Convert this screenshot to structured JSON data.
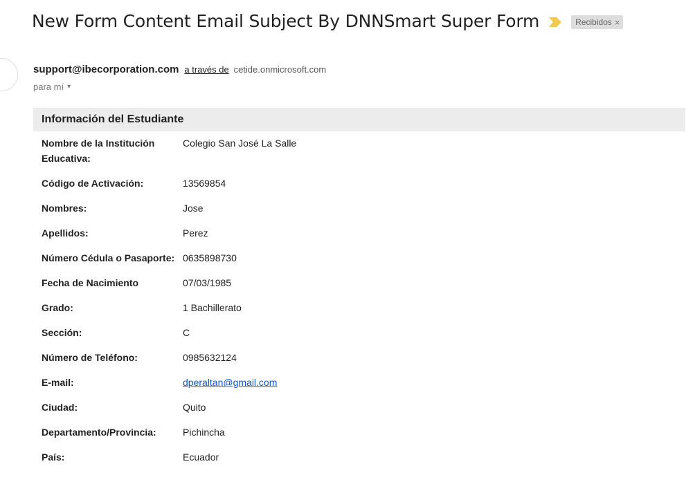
{
  "email": {
    "subject": "New Form Content Email Subject By DNNSmart Super Form",
    "label": "Recibidos",
    "label_close": "×",
    "importance_color": "#f2c94c",
    "sender": {
      "email": "support@ibecorporation.com",
      "via_text": "a través de",
      "via_domain": "cetide.onmicrosoft.com"
    },
    "recipient_text": "para mí",
    "recipient_caret": "▾"
  },
  "form": {
    "header": "Información del Estudiante",
    "rows": [
      {
        "label": "Nombre de la Institución Educativa:",
        "value": "Colegio San José La Salle"
      },
      {
        "label": "Código de Activación:",
        "value": "13569854"
      },
      {
        "label": "Nombres:",
        "value": "Jose"
      },
      {
        "label": "Apellidos:",
        "value": "Perez"
      },
      {
        "label": "Número Cédula o Pasaporte:",
        "value": "0635898730"
      },
      {
        "label": "Fecha de Nacimiento",
        "value": "07/03/1985"
      },
      {
        "label": "Grado:",
        "value": "1 Bachillerato"
      },
      {
        "label": "Sección:",
        "value": "C"
      },
      {
        "label": "Número de Teléfono:",
        "value": "0985632124"
      },
      {
        "label": "E-mail:",
        "value": "dperaltan@gmail.com"
      },
      {
        "label": "Ciudad:",
        "value": "Quito"
      },
      {
        "label": "Departamento/Provincia:",
        "value": "Pichincha"
      },
      {
        "label": "País:",
        "value": "Ecuador"
      }
    ]
  }
}
